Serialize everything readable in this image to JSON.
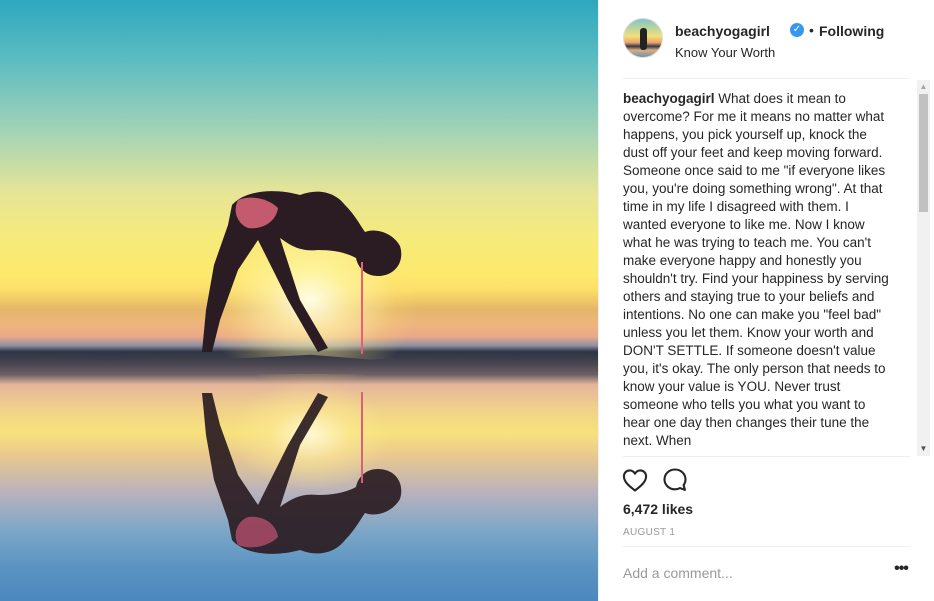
{
  "post": {
    "username": "beachyogagirl",
    "verified_icon": "verified-badge-icon",
    "separator": "•",
    "follow_status": "Following",
    "location": "Know Your Worth",
    "caption_author": "beachyogagirl",
    "caption_text": "What does it mean to overcome? For me it means no matter what happens, you pick yourself up, knock the dust off your feet and keep moving forward. Someone once said to me \"if everyone likes you, you're doing something wrong\". At that time in my life I disagreed with them. I wanted everyone to like me. Now I know what he was trying to teach me. You can't make everyone happy and honestly you shouldn't try. Find your happiness by serving others and staying true to your beliefs and intentions. No one can make you \"feel bad\" unless you let them. Know your worth and DON'T SETTLE. If someone doesn't value you, it's okay. The only person that needs to know your value is YOU. Never trust someone who tells you what you want to hear one day then changes their tune the next. When",
    "likes": "6,472 likes",
    "date": "AUGUST 1"
  },
  "actions": {
    "like_icon": "heart-icon",
    "comment_icon": "comment-icon"
  },
  "comment": {
    "placeholder": "Add a comment...",
    "more_label": "•••"
  },
  "scrollbar": {
    "up_arrow": "▲",
    "down_arrow": "▼"
  },
  "colors": {
    "accent": "#3897f0",
    "text": "#262626",
    "muted": "#999999",
    "divider": "#efefef"
  }
}
